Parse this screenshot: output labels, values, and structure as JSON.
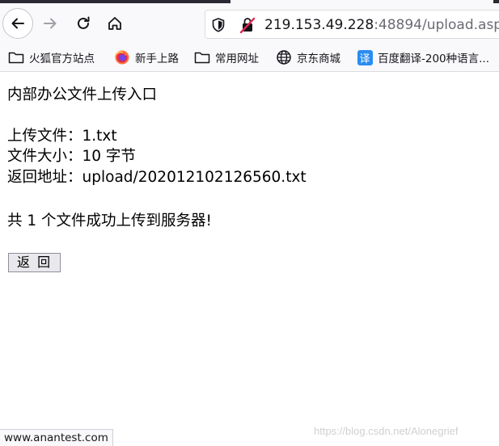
{
  "browser": {
    "url_host": "219.153.49.228",
    "url_rest": ":48894/upload.asp",
    "icons": {
      "back": "back-arrow-icon",
      "forward": "forward-arrow-icon",
      "reload": "reload-icon",
      "home": "home-icon",
      "tracking": "shield-icon",
      "insecure": "insecure-lock-icon"
    }
  },
  "bookmarks": [
    {
      "label": "火狐官方站点",
      "icon": "folder-icon"
    },
    {
      "label": "新手上路",
      "icon": "firefox-icon"
    },
    {
      "label": "常用网址",
      "icon": "folder-icon"
    },
    {
      "label": "京东商城",
      "icon": "globe-icon"
    },
    {
      "label": "百度翻译-200种语言...",
      "icon": "fanyi-icon",
      "icon_text": "译"
    }
  ],
  "page": {
    "heading": "内部办公文件上传入口",
    "fields": [
      {
        "label": "上传文件：",
        "value": "1.txt"
      },
      {
        "label": "文件大小：",
        "value": "10 字节"
      },
      {
        "label": "返回地址：",
        "value": "upload/202012102126560.txt"
      }
    ],
    "summary": "共 1 个文件成功上传到服务器!",
    "back_label": "返 回"
  },
  "status": {
    "link": "www.anantest.com",
    "watermark": "https://blog.csdn.net/Alonegrief"
  },
  "colors": {
    "toolbar": "#f9f9fb",
    "insecure_red": "#e22850",
    "fanyi_blue": "#2a8cf2"
  }
}
